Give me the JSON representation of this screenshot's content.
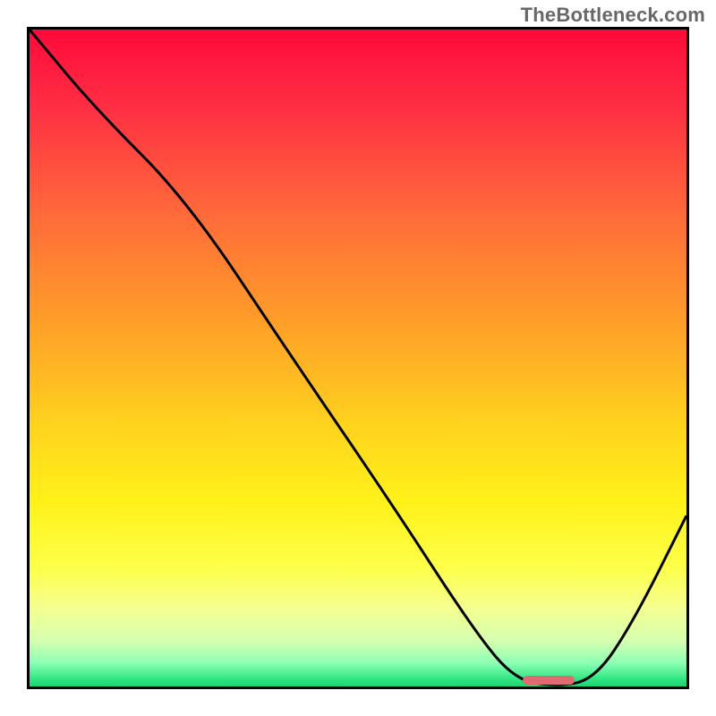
{
  "watermark": "TheBottleneck.com",
  "colors": {
    "curve_stroke": "#000000",
    "marker_fill": "#e06a72",
    "border": "#000000"
  },
  "chart_data": {
    "type": "line",
    "title": "",
    "xlabel": "",
    "ylabel": "",
    "xlim": [
      0,
      100
    ],
    "ylim": [
      0,
      100
    ],
    "grid": false,
    "legend": null,
    "comment": "Axes unlabeled; values estimated from curve position as % of plot width/height. y=100 top, y=0 bottom.",
    "series": [
      {
        "name": "bottleneck-curve",
        "x": [
          0,
          10,
          24,
          40,
          55,
          68,
          74,
          80,
          86,
          92,
          100
        ],
        "y": [
          100,
          88,
          74,
          50,
          28,
          8,
          1,
          0,
          1,
          10,
          26
        ]
      }
    ],
    "marker": {
      "comment": "Pink rounded marker at curve trough",
      "x_start": 75,
      "x_end": 83,
      "y": 0.5
    },
    "background_gradient": {
      "stops": [
        {
          "pos": 0,
          "color": "#ff0a3a"
        },
        {
          "pos": 12,
          "color": "#ff2f44"
        },
        {
          "pos": 28,
          "color": "#ff6a3a"
        },
        {
          "pos": 45,
          "color": "#ffa028"
        },
        {
          "pos": 60,
          "color": "#ffd21e"
        },
        {
          "pos": 72,
          "color": "#fff21a"
        },
        {
          "pos": 82,
          "color": "#fdff4a"
        },
        {
          "pos": 88,
          "color": "#f5ff8f"
        },
        {
          "pos": 93,
          "color": "#d6ffb0"
        },
        {
          "pos": 96.5,
          "color": "#8affb4"
        },
        {
          "pos": 99,
          "color": "#2be57f"
        },
        {
          "pos": 100,
          "color": "#1dd36f"
        }
      ]
    }
  }
}
